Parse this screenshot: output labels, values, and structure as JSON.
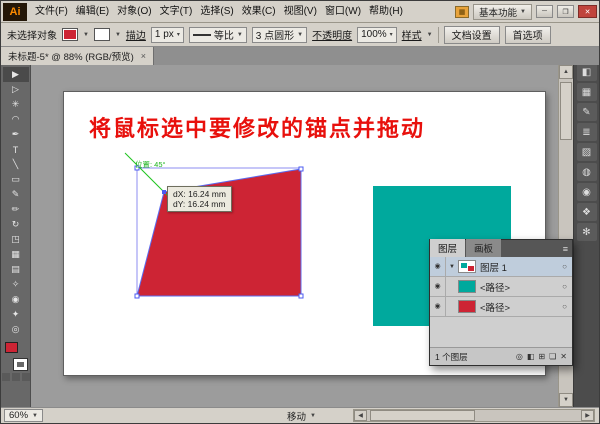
{
  "ui": {
    "dropdown_arrow": "▼",
    "spinner": "▾"
  },
  "menubar": {
    "logo": "Ai",
    "menus": [
      "文件(F)",
      "编辑(E)",
      "对象(O)",
      "文字(T)",
      "选择(S)",
      "效果(C)",
      "视图(V)",
      "窗口(W)",
      "帮助(H)"
    ],
    "arrange_icon": "▦",
    "workspace": "基本功能",
    "window": {
      "minimize": "─",
      "restore": "❐",
      "close": "✕"
    }
  },
  "controlbar": {
    "no_selection": "未选择对象",
    "stroke_label": "描边",
    "stroke_value": "1 px",
    "profile_value": "等比",
    "brush_value": "3 点圆形",
    "opacity_label": "不透明度",
    "opacity_value": "100%",
    "style_label": "样式",
    "document_setup": "文档设置",
    "preferences": "首选项"
  },
  "tabbar": {
    "title": "未标题-5* @ 88% (RGB/预览)",
    "close": "×"
  },
  "tools": [
    {
      "name": "selection",
      "glyph": "▶"
    },
    {
      "name": "direct-selection",
      "glyph": "▷"
    },
    {
      "name": "magic-wand",
      "glyph": "✳"
    },
    {
      "name": "lasso",
      "glyph": "◠"
    },
    {
      "name": "pen",
      "glyph": "✒"
    },
    {
      "name": "type",
      "glyph": "T"
    },
    {
      "name": "line-segment",
      "glyph": "╲"
    },
    {
      "name": "rectangle",
      "glyph": "▭"
    },
    {
      "name": "paintbrush",
      "glyph": "✎"
    },
    {
      "name": "pencil",
      "glyph": "✏"
    },
    {
      "name": "rotate",
      "glyph": "↻"
    },
    {
      "name": "scale",
      "glyph": "◳"
    },
    {
      "name": "mesh",
      "glyph": "▦"
    },
    {
      "name": "gradient",
      "glyph": "▤"
    },
    {
      "name": "eyedropper",
      "glyph": "✧"
    },
    {
      "name": "blend",
      "glyph": "◉"
    },
    {
      "name": "hand",
      "glyph": "✦"
    },
    {
      "name": "zoom",
      "glyph": "◎"
    }
  ],
  "canvas": {
    "heading": "将鼠标选中要修改的锚点并拖动",
    "guide_label": "位置: 45°",
    "tooltip": [
      "dX: 16.24 mm",
      "dY: 16.24 mm"
    ],
    "colors": {
      "red_shape": "#cd2434",
      "teal_shape": "#00a99d",
      "heading_red": "#e8100c",
      "smart_guide_green": "#22c522",
      "selection_blue": "#5b6bf0"
    }
  },
  "layers_panel": {
    "tabs": [
      "图层",
      "画板"
    ],
    "panel_menu": "≡",
    "rows": [
      {
        "label": "图层 1",
        "eye": "◉",
        "expander": "▼",
        "target": "○"
      },
      {
        "label": "<路径>",
        "eye": "◉",
        "target": "○",
        "color": "#00a99d"
      },
      {
        "label": "<路径>",
        "eye": "◉",
        "target": "○",
        "color": "#cd2434"
      }
    ],
    "status": "1 个图层",
    "footer_icons": [
      {
        "name": "locate-object",
        "glyph": "◎"
      },
      {
        "name": "make-clip-mask",
        "glyph": "◧"
      },
      {
        "name": "new-sublayer",
        "glyph": "⊞"
      },
      {
        "name": "new-layer",
        "glyph": "❏"
      },
      {
        "name": "delete-layer",
        "glyph": "✕"
      }
    ]
  },
  "right_strip": {
    "collapse": "«",
    "icons": [
      {
        "name": "color-panel",
        "glyph": "◧"
      },
      {
        "name": "swatches-panel",
        "glyph": "▦"
      },
      {
        "name": "brushes-panel",
        "glyph": "✎"
      },
      {
        "name": "stroke-panel",
        "glyph": "≣"
      },
      {
        "name": "gradient-panel",
        "glyph": "▨"
      },
      {
        "name": "transparency-panel",
        "glyph": "◍"
      },
      {
        "name": "appearance-panel",
        "glyph": "◉"
      },
      {
        "name": "graphic-styles-panel",
        "glyph": "❖"
      },
      {
        "name": "symbols-panel",
        "glyph": "✻"
      }
    ]
  },
  "scrollbars": {
    "up": "▲",
    "down": "▼",
    "left": "◀",
    "right": "▶"
  },
  "statusbar": {
    "zoom": "60%",
    "tool": "移动"
  }
}
